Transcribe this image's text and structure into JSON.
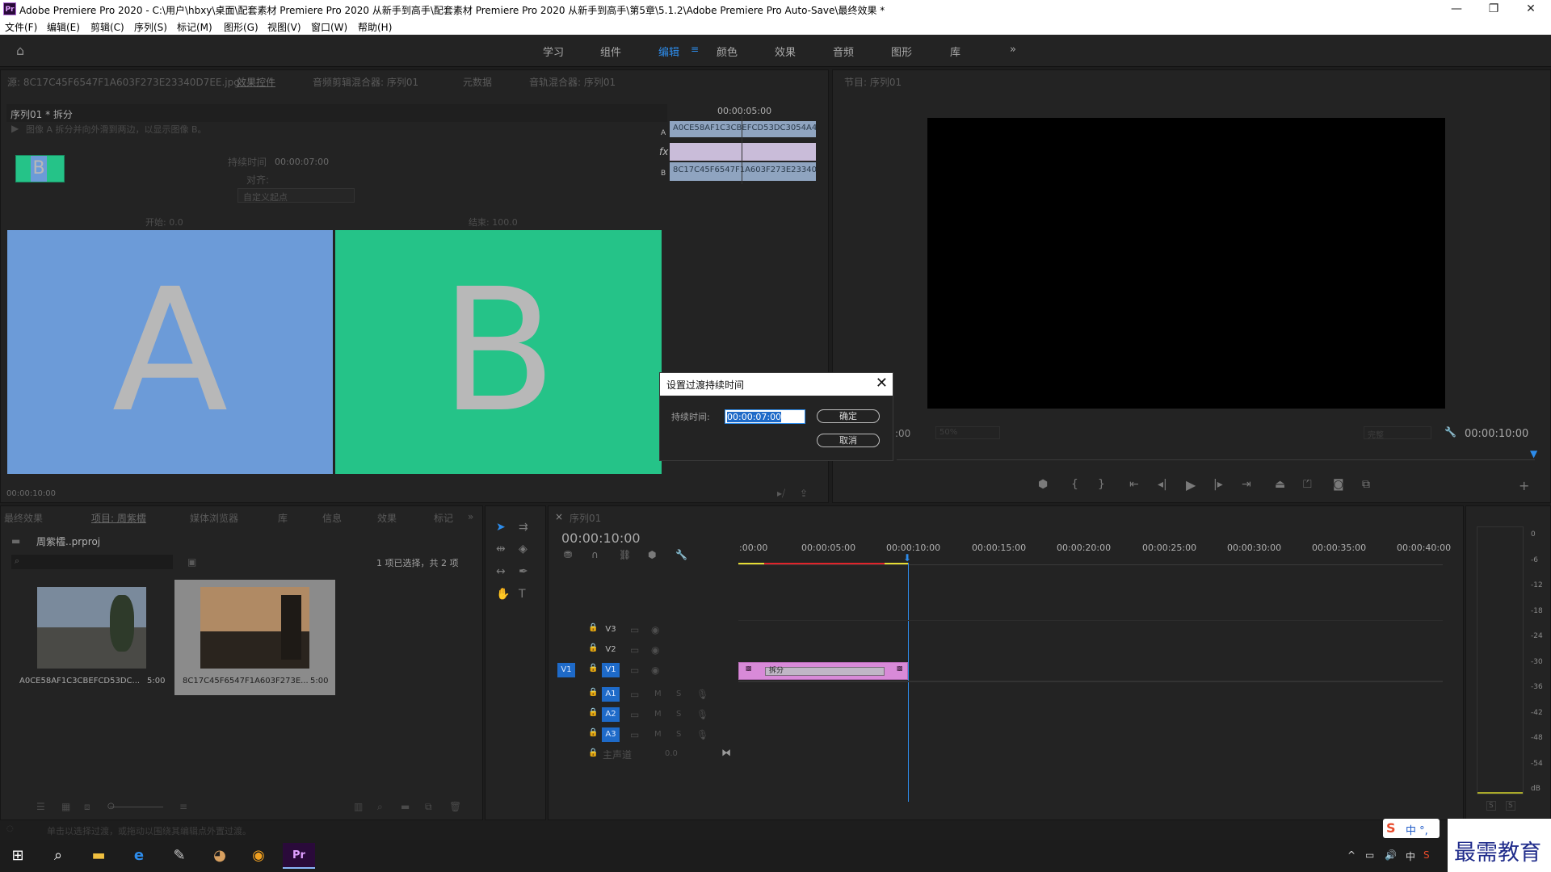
{
  "titlebar": {
    "app_icon": "Pr",
    "title": "Adobe Premiere Pro 2020 - C:\\用户\\hbxy\\桌面\\配套素材 Premiere Pro 2020 从新手到高手\\配套素材 Premiere Pro 2020 从新手到高手\\第5章\\5.1.2\\Adobe Premiere Pro Auto-Save\\最终效果 *",
    "minimize": "—",
    "restore": "❐",
    "close": "✕"
  },
  "menu": [
    "文件(F)",
    "编辑(E)",
    "剪辑(C)",
    "序列(S)",
    "标记(M)",
    "图形(G)",
    "视图(V)",
    "窗口(W)",
    "帮助(H)"
  ],
  "workspaces": {
    "items": [
      "学习",
      "组件",
      "编辑",
      "颜色",
      "效果",
      "音频",
      "图形",
      "库"
    ],
    "active": "编辑",
    "more": "»"
  },
  "source_panel": {
    "tabs": [
      "源: 8C17C45F6547F1A603F273E23340D7EE.jpg",
      "效果控件",
      "音频剪辑混合器: 序列01",
      "元数据",
      "音轨混合器: 序列01"
    ],
    "clip_path": "序列01 * 拆分",
    "description": "图像 A 拆分并向外滑到两边，以显示图像 B。",
    "duration_label": "持续时间",
    "duration_value": "00:00:07:00",
    "align_label": "对齐:",
    "align_value": "自定义起点",
    "start_label": "开始: 0.0",
    "end_label": "结束: 100.0",
    "image_a": "A",
    "image_b": "B",
    "timecode": "00:00:10:00",
    "mini_timecode": "00:00:05:00",
    "clip_a": "A0CE58AF1C3CBEFCD53DC3054A4",
    "clip_b": "8C17C45F6547F1A603F273E23340D",
    "track_a": "A",
    "track_b": "B",
    "fx": "fx"
  },
  "program_panel": {
    "tab": "节目: 序列01",
    "zoom": "50%",
    "quality": "完整",
    "timecode": "00:00:10:00",
    "left_tc": ":00"
  },
  "project_panel": {
    "tabs": [
      "最终效果",
      "项目: 周紫櫺",
      "媒体浏览器",
      "库",
      "信息",
      "效果",
      "标记"
    ],
    "project_name": "周紫櫺..prproj",
    "selection_info": "1 项已选择，共 2 项",
    "items": [
      {
        "name": "A0CE58AF1C3CBEFCD53DC...",
        "duration": "5:00"
      },
      {
        "name": "8C17C45F6547F1A603F273E...",
        "duration": "5:00"
      }
    ]
  },
  "timeline": {
    "tab": "序列01",
    "timecode": "00:00:10:00",
    "ruler": [
      ":00:00",
      "00:00:05:00",
      "00:00:10:00",
      "00:00:15:00",
      "00:00:20:00",
      "00:00:25:00",
      "00:00:30:00",
      "00:00:35:00",
      "00:00:40:00"
    ],
    "video_tracks": [
      "V3",
      "V2",
      "V1"
    ],
    "audio_tracks": [
      "A1",
      "A2",
      "A3"
    ],
    "source_v1": "V1",
    "master": "主声道",
    "master_value": "0.0",
    "mute": "M",
    "solo": "S",
    "transition_label": "拆分"
  },
  "meter": {
    "scale": [
      "0",
      "-6",
      "-12",
      "-18",
      "-24",
      "-30",
      "-36",
      "-42",
      "-48",
      "-54",
      "dB"
    ],
    "solo_left": "S",
    "solo_right": "S"
  },
  "dialog": {
    "title": "设置过渡持续时间",
    "close": "✕",
    "field_label": "持续时间:",
    "field_value": "00:00:07:00",
    "ok": "确定",
    "cancel": "取消"
  },
  "status_bar": "单击以选择过渡，或拖动以围绕其编辑点外置过渡。",
  "watermark": "最需教育",
  "ime": "中 °,"
}
